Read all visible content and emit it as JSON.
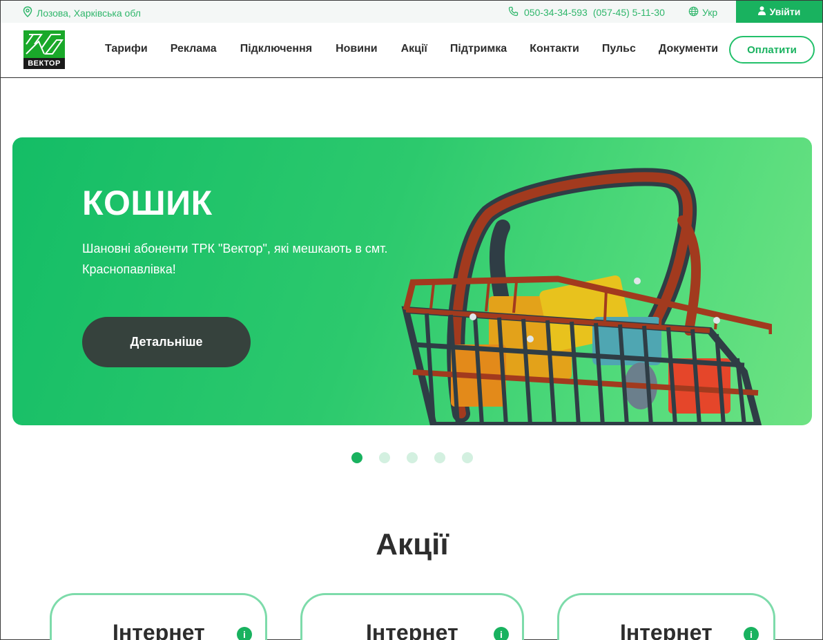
{
  "topbar": {
    "location": "Лозова, Харківська обл",
    "phone1": "050-34-34-593",
    "phone2": "(057-45) 5-11-30",
    "language": "Укр",
    "login": "Увійти"
  },
  "header": {
    "logo_text": "ВЕКТОР",
    "nav": [
      "Тарифи",
      "Реклама",
      "Підключення",
      "Новини",
      "Акції",
      "Підтримка",
      "Контакти",
      "Пульс",
      "Документи"
    ],
    "pay_button": "Оплатити"
  },
  "banner": {
    "title": "КОШИК",
    "text": "Шановні абоненти ТРК \"Вектор\", які мешкають в смт. Краснопавлівка!",
    "button": "Детальніше"
  },
  "slider": {
    "count": 5,
    "active_index": 0
  },
  "promos": {
    "title": "Акції",
    "cards": [
      {
        "title": "Інтернет"
      },
      {
        "title": "Інтернет"
      },
      {
        "title": "Інтернет"
      }
    ]
  },
  "colors": {
    "accent": "#19b25f",
    "dark_button": "#36423d"
  }
}
